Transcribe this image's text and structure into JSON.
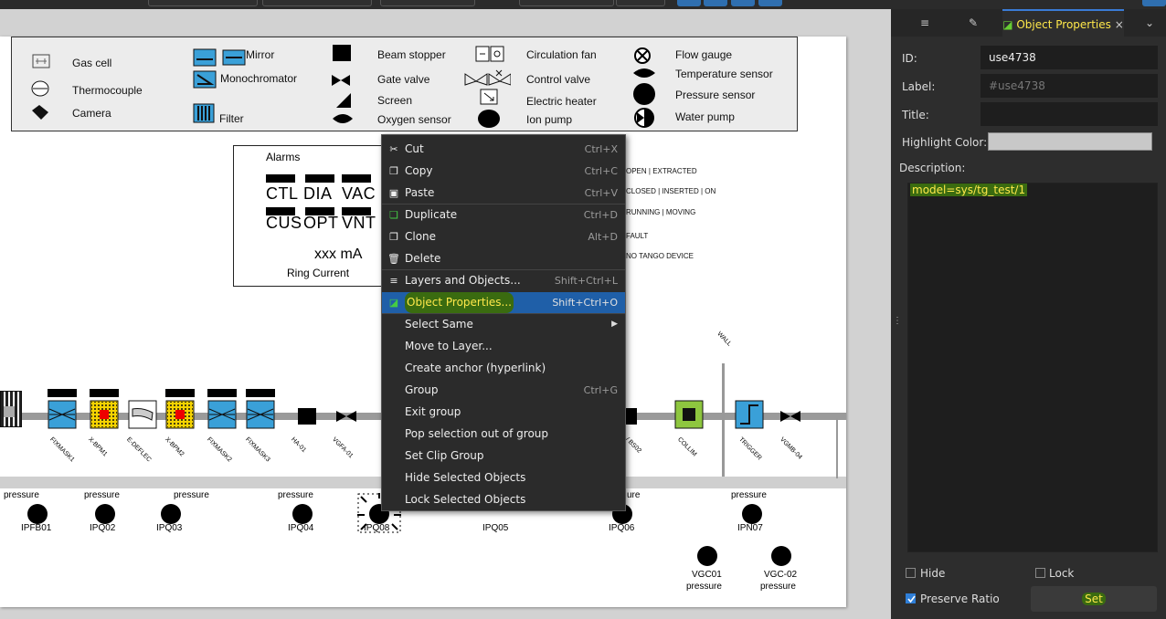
{
  "legend": {
    "col1": [
      "Gas cell",
      "Thermocouple",
      "Camera"
    ],
    "col2": [
      "Mirror",
      "Monochromator",
      "Filter"
    ],
    "col3": [
      "Beam stopper",
      "Gate valve",
      "Screen",
      "Oxygen sensor"
    ],
    "col4": [
      "Circulation fan",
      "Control valve",
      "Electric heater",
      "Ion pump"
    ],
    "col5": [
      "Flow gauge",
      "Temperature sensor",
      "Pressure sensor",
      "Water pump"
    ]
  },
  "alarms": {
    "title": "Alarms",
    "row1": [
      "CTL",
      "DIA",
      "VAC"
    ],
    "row2": [
      "CUS",
      "OPT",
      "VNT"
    ],
    "current": "xxx mA",
    "current_label": "Ring Current"
  },
  "state_legend": [
    "OPEN  | EXTRACTED",
    "CLOSED  | INSERTED  |  ON",
    "RUNNING |  MOVING",
    "FAULT",
    "NO TANGO DEVICE"
  ],
  "devices": [
    "FIXMASK1",
    "X-BPM1",
    "E-DEFLEC",
    "X-BPM2",
    "FIXMASK2",
    "FIXMASK3",
    "HA-01",
    "VGFA-01",
    "/ BS02",
    "COLLIM",
    "TRIGGER",
    "VGMB-04"
  ],
  "wall_label": "WALL",
  "pressure_label": "pressure",
  "gauges": {
    "row": [
      "IPFB01",
      "IPQ02",
      "IPQ03",
      "IPQ04",
      "IPQ08",
      "IPQ05",
      "IPQ06",
      "IPN07"
    ],
    "bottom": [
      "VGC01",
      "VGC-02"
    ]
  },
  "context_menu": {
    "items": [
      {
        "icon": "cut-icon",
        "glyph": "✂",
        "label": "Cut",
        "shortcut": "Ctrl+X"
      },
      {
        "icon": "copy-icon",
        "glyph": "❐",
        "label": "Copy",
        "shortcut": "Ctrl+C"
      },
      {
        "icon": "paste-icon",
        "glyph": "▣",
        "label": "Paste",
        "shortcut": "Ctrl+V"
      },
      {
        "icon": "duplicate-icon",
        "glyph": "❏",
        "label": "Duplicate",
        "shortcut": "Ctrl+D"
      },
      {
        "icon": "clone-icon",
        "glyph": "❐",
        "label": "Clone",
        "shortcut": "Alt+D"
      },
      {
        "icon": "delete-icon",
        "glyph": "🗑",
        "label": "Delete",
        "shortcut": ""
      },
      {
        "icon": "layers-icon",
        "glyph": "≡",
        "label": "Layers and Objects...",
        "shortcut": "Shift+Ctrl+L"
      },
      {
        "icon": "object-properties-icon",
        "glyph": "◪",
        "label": "Object Properties...",
        "shortcut": "Shift+Ctrl+O"
      },
      {
        "icon": "",
        "glyph": "",
        "label": "Select Same",
        "shortcut": ""
      },
      {
        "icon": "",
        "glyph": "",
        "label": "Move to Layer...",
        "shortcut": ""
      },
      {
        "icon": "",
        "glyph": "",
        "label": "Create anchor (hyperlink)",
        "shortcut": ""
      },
      {
        "icon": "",
        "glyph": "",
        "label": "Group",
        "shortcut": "Ctrl+G"
      },
      {
        "icon": "",
        "glyph": "",
        "label": "Exit group",
        "shortcut": ""
      },
      {
        "icon": "",
        "glyph": "",
        "label": "Pop selection out of group",
        "shortcut": ""
      },
      {
        "icon": "",
        "glyph": "",
        "label": "Set Clip Group",
        "shortcut": ""
      },
      {
        "icon": "",
        "glyph": "",
        "label": "Hide Selected Objects",
        "shortcut": ""
      },
      {
        "icon": "",
        "glyph": "",
        "label": "Lock Selected Objects",
        "shortcut": ""
      }
    ]
  },
  "panel": {
    "tab_active": "Object Properties",
    "close_glyph": "×",
    "fields": {
      "id_label": "ID:",
      "id_value": "use4738",
      "label_label": "Label:",
      "label_placeholder": "#use4738",
      "title_label": "Title:",
      "title_value": "",
      "highlight_label": "Highlight Color:",
      "description_label": "Description:",
      "description_value": "model=sys/tg_test/1"
    },
    "hide_label": "Hide",
    "lock_label": "Lock",
    "preserve_label": "Preserve Ratio",
    "set_label": "Set",
    "preserve_checked": true
  },
  "colors": {
    "menu_bg": "#2b2b2b",
    "menu_selected": "#1f5fa8",
    "highlight_green": "#3a6b10",
    "highlight_yellow": "#ffe84a",
    "device_blue": "#3aa0d8",
    "collim_green": "#8ec63f"
  }
}
